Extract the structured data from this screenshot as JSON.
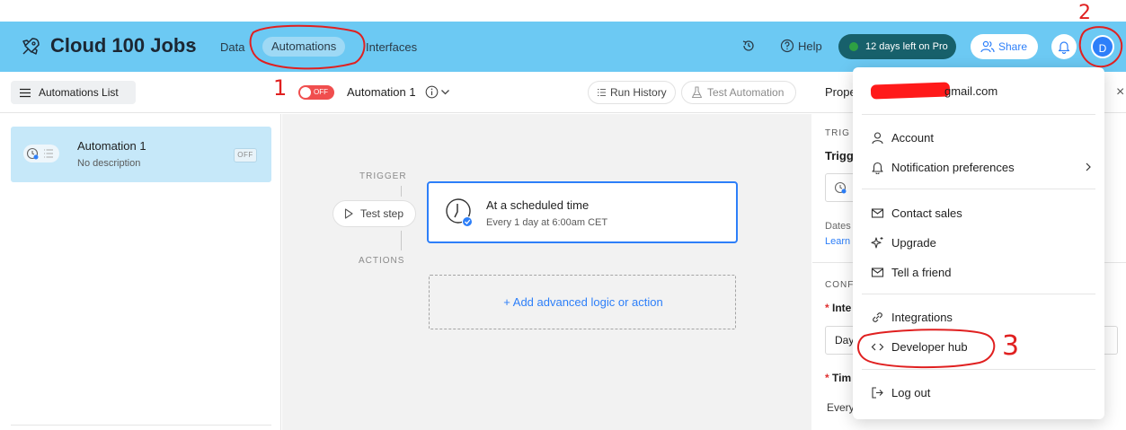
{
  "topbar": {
    "base_name": "Cloud 100 Jobs",
    "tabs": [
      {
        "label": "Data",
        "active": false
      },
      {
        "label": "Automations",
        "active": true
      },
      {
        "label": "Interfaces",
        "active": false
      }
    ],
    "help_label": "Help",
    "trial_label": "12 days left on Pro",
    "share_label": "Share",
    "avatar_initial": "D",
    "bg_color": "#6cc9f3"
  },
  "subbar": {
    "list_button": "Automations List",
    "toggle_label": "OFF",
    "automation_name": "Automation 1",
    "run_history": "Run History",
    "test_automation": "Test Automation",
    "properties_title": "Prope"
  },
  "sidebar": {
    "items": [
      {
        "title": "Automation 1",
        "description": "No description",
        "status": "OFF"
      }
    ]
  },
  "canvas": {
    "trigger_label": "TRIGGER",
    "actions_label": "ACTIONS",
    "test_step": "Test step",
    "trigger_title": "At a scheduled time",
    "trigger_sub": "Every 1 day at 6:00am CET",
    "add_action": "+ Add advanced logic or action"
  },
  "props": {
    "trig_heading": "TRIG",
    "trig_sub": "Trigg",
    "dates": "Dates",
    "learn": "Learn",
    "conf_heading": "CONF",
    "interval_label": "Inte",
    "interval_value": "Day",
    "time_label": "Tim",
    "every_label": "Every",
    "required_mark": "*"
  },
  "dropdown": {
    "email_visible": "gmail.com",
    "items": [
      {
        "label": "Account",
        "icon": "user-icon"
      },
      {
        "label": "Notification preferences",
        "icon": "bell-icon"
      },
      {
        "label": "Contact sales",
        "icon": "mail-icon"
      },
      {
        "label": "Upgrade",
        "icon": "sparkle-icon"
      },
      {
        "label": "Tell a friend",
        "icon": "mail-icon"
      },
      {
        "label": "Integrations",
        "icon": "link-icon"
      },
      {
        "label": "Developer hub",
        "icon": "code-icon"
      },
      {
        "label": "Log out",
        "icon": "logout-icon"
      }
    ]
  },
  "annotations": {
    "step1": "1",
    "step2": "2",
    "step3": "3",
    "color": "#e02020"
  },
  "colors": {
    "accent": "#2d7ff9",
    "trial_bg": "#17606b",
    "toggle_off": "#f04e4e",
    "card_selected": "#c6e8f9"
  }
}
